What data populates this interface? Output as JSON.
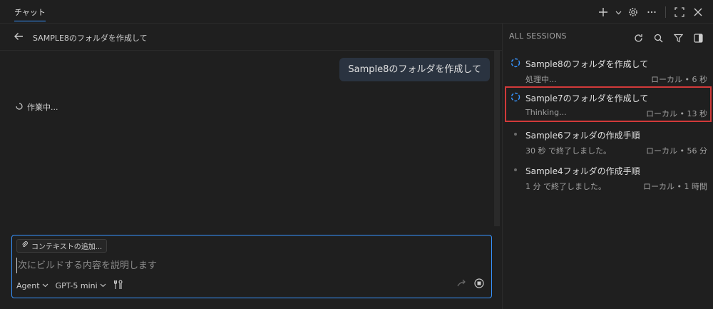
{
  "topbar": {
    "tab_label": "チャット",
    "icons": [
      "plus-icon",
      "chevron-down-icon",
      "gear-icon",
      "more-icon",
      "maximize-icon",
      "close-icon"
    ]
  },
  "chat": {
    "title": "SAMPLE8のフォルダを作成して",
    "user_message": "Sample8のフォルダを作成して",
    "working_text": "作業中..."
  },
  "input": {
    "context_button": "コンテキストの追加...",
    "placeholder": "次にビルドする内容を説明します",
    "mode": "Agent",
    "model": "GPT-5 mini"
  },
  "sessions": {
    "header": "ALL SESSIONS",
    "items": [
      {
        "title": "Sample8のフォルダを作成して",
        "status": "処理中...",
        "meta": "ローカル • 6 秒",
        "state": "running"
      },
      {
        "title": "Sample7のフォルダを作成して",
        "status": "Thinking...",
        "meta": "ローカル • 13 秒",
        "state": "running"
      },
      {
        "title": "Sample6フォルダの作成手順",
        "status": "30 秒 で終了しました。",
        "meta": "ローカル • 56 分",
        "state": "done"
      },
      {
        "title": "Sample4フォルダの作成手順",
        "status": "1 分 で終了しました。",
        "meta": "ローカル • 1 時間",
        "state": "done"
      }
    ]
  },
  "colors": {
    "accent": "#3794ff",
    "selection_border": "#d23a3a",
    "background": "#1f1f1f"
  }
}
